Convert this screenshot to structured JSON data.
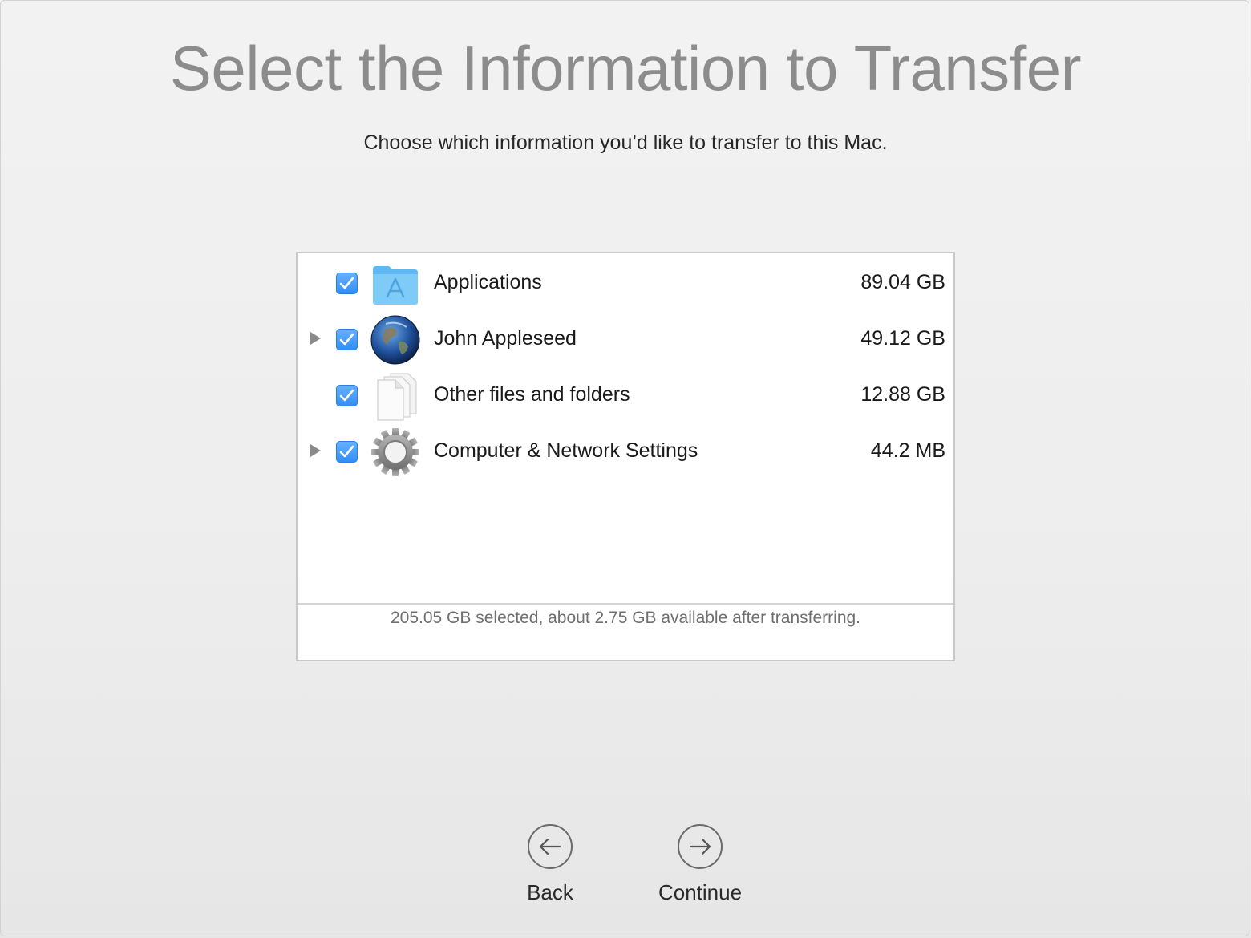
{
  "title": "Select the Information to Transfer",
  "subtitle": "Choose which information you’d like to transfer to this Mac.",
  "items": [
    {
      "label": "Applications",
      "size": "89.04 GB",
      "checked": true,
      "expandable": false,
      "icon": "applications-folder-icon"
    },
    {
      "label": "John Appleseed",
      "size": "49.12 GB",
      "checked": true,
      "expandable": true,
      "icon": "user-globe-icon"
    },
    {
      "label": "Other files and folders",
      "size": "12.88 GB",
      "checked": true,
      "expandable": false,
      "icon": "documents-icon"
    },
    {
      "label": "Computer & Network Settings",
      "size": "44.2 MB",
      "checked": true,
      "expandable": true,
      "icon": "gear-icon"
    }
  ],
  "summary": "205.05 GB selected, about 2.75 GB available after transferring.",
  "nav": {
    "back_label": "Back",
    "continue_label": "Continue"
  },
  "colors": {
    "checkbox": "#2f8df5",
    "title": "#8c8c8c",
    "folder": "#6cc0f5"
  }
}
